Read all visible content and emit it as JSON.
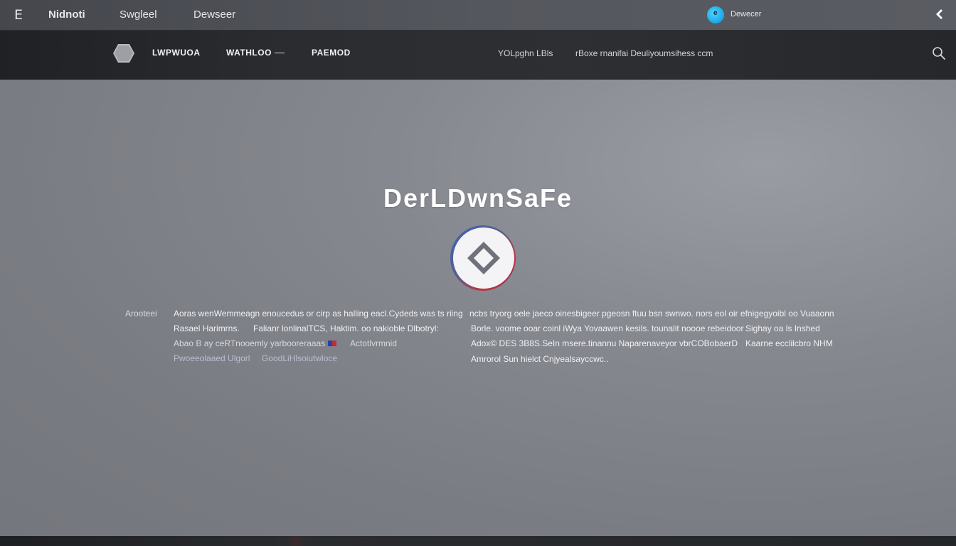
{
  "topbar": {
    "menu_glyph": "E",
    "nav": [
      "Nidnoti",
      "Swgleel",
      "Dewseer"
    ],
    "status_dot_text": "e",
    "status_label": "Dewecer"
  },
  "navbar": {
    "items": [
      "LWPWUOA",
      "WATHLOO",
      "PAEMOD"
    ],
    "links": [
      "YOLpghn LBls",
      "rBoxe rnanifai Deuliyoumsihess ccm"
    ]
  },
  "hero": {
    "title": "DerLDwnSaFe"
  },
  "content": {
    "label": "Arooteei",
    "lines": [
      "Aoras wenWemmeagn enoucedus or cirp as halling eacl.Cydeds was ts riing",
      "Rasael Harimrns.",
      "Falianr lonlinalTCS, Haktim. oo nakioble Dlbotryl:",
      "Abao B ay  ceRTnooemly yarbooreraaas",
      "Actotlvrmnid",
      "Pwoeeolaaed Ulgorl",
      "GoodLiHlsoiutwloce",
      "ncbs tryorg oele jaeco oinesbigeer pgeosn ftuu bsn swnwo. nors eol oir efnigegyoibl oo Vuaaonn",
      "Borle. voome ooar coinl iWya Yovaawen kesils. tounalit noooe rebeidoor",
      "Sighay oa ls Inshed",
      "Adox© DES 3B8S.SeIn msere.tinannu Naparenaveyor vbrCOBobaerD",
      "Kaarne ecclilcbro NHM",
      "Amrorol Sun hielct Cnjyealsayccwc.."
    ]
  },
  "colors": {
    "accent": "#17a7e8",
    "topbar": "#4d4f55",
    "navbar": "#2a2c30",
    "background": "#84868d"
  },
  "icons": {
    "menu": "menu-icon",
    "status": "status-dot-icon",
    "back": "back-chevron-icon",
    "logo": "hexagon-logo-icon",
    "search": "search-icon",
    "badge": "diamond-badge-icon",
    "flag": "flag-icon"
  }
}
